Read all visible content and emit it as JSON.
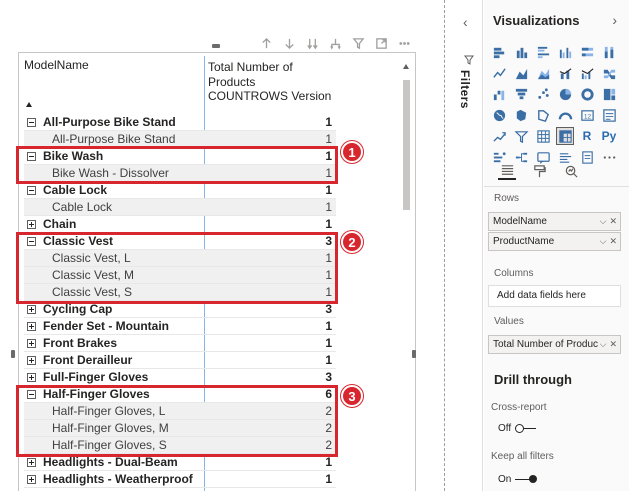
{
  "matrix": {
    "column_headers": {
      "model": "ModelName",
      "total_line1": "Total Number of",
      "total_line2": "Products",
      "total_line3": "COUNTROWS Version"
    },
    "rows": [
      {
        "label": "All-Purpose Bike Stand",
        "value": "1",
        "level": 0,
        "expanded": true
      },
      {
        "label": "All-Purpose Bike Stand",
        "value": "1",
        "level": 1
      },
      {
        "label": "Bike Wash",
        "value": "1",
        "level": 0,
        "expanded": true
      },
      {
        "label": "Bike Wash - Dissolver",
        "value": "1",
        "level": 1
      },
      {
        "label": "Cable Lock",
        "value": "1",
        "level": 0,
        "expanded": true
      },
      {
        "label": "Cable Lock",
        "value": "1",
        "level": 1
      },
      {
        "label": "Chain",
        "value": "1",
        "level": 0,
        "expanded": false
      },
      {
        "label": "Classic Vest",
        "value": "3",
        "level": 0,
        "expanded": true
      },
      {
        "label": "Classic Vest, L",
        "value": "1",
        "level": 1
      },
      {
        "label": "Classic Vest, M",
        "value": "1",
        "level": 1
      },
      {
        "label": "Classic Vest, S",
        "value": "1",
        "level": 1
      },
      {
        "label": "Cycling Cap",
        "value": "3",
        "level": 0,
        "expanded": false
      },
      {
        "label": "Fender Set - Mountain",
        "value": "1",
        "level": 0,
        "expanded": false
      },
      {
        "label": "Front Brakes",
        "value": "1",
        "level": 0,
        "expanded": false
      },
      {
        "label": "Front Derailleur",
        "value": "1",
        "level": 0,
        "expanded": false
      },
      {
        "label": "Full-Finger Gloves",
        "value": "3",
        "level": 0,
        "expanded": false
      },
      {
        "label": "Half-Finger Gloves",
        "value": "6",
        "level": 0,
        "expanded": true
      },
      {
        "label": "Half-Finger Gloves, L",
        "value": "2",
        "level": 1
      },
      {
        "label": "Half-Finger Gloves, M",
        "value": "2",
        "level": 1
      },
      {
        "label": "Half-Finger Gloves, S",
        "value": "2",
        "level": 1
      },
      {
        "label": "Headlights - Dual-Beam",
        "value": "1",
        "level": 0,
        "expanded": false
      },
      {
        "label": "Headlights - Weatherproof",
        "value": "1",
        "level": 0,
        "expanded": false
      }
    ],
    "callouts": [
      "1",
      "2",
      "3"
    ]
  },
  "toolbar_icons": [
    "drill-up-icon",
    "drill-down-icon",
    "expand-next-level-icon",
    "expand-hierarchy-icon",
    "filter-icon",
    "focus-mode-icon",
    "more-options-icon"
  ],
  "filters": {
    "label": "Filters"
  },
  "visualizations": {
    "title": "Visualizations",
    "icon_r": "R",
    "icon_py": "Py",
    "rows_label": "Rows",
    "rows_fields": [
      "ModelName",
      "ProductName"
    ],
    "columns_label": "Columns",
    "columns_placeholder": "Add data fields here",
    "values_label": "Values",
    "values_fields": [
      "Total Number of Produc"
    ],
    "drill_through": "Drill through",
    "cross_report": "Cross-report",
    "cross_report_state": "Off",
    "keep_all_filters": "Keep all filters",
    "keep_all_filters_state": "On"
  },
  "colors": {
    "callout": "#d8262e",
    "column_separator": "#8ab4e8",
    "accent": "#2b6cb0"
  }
}
